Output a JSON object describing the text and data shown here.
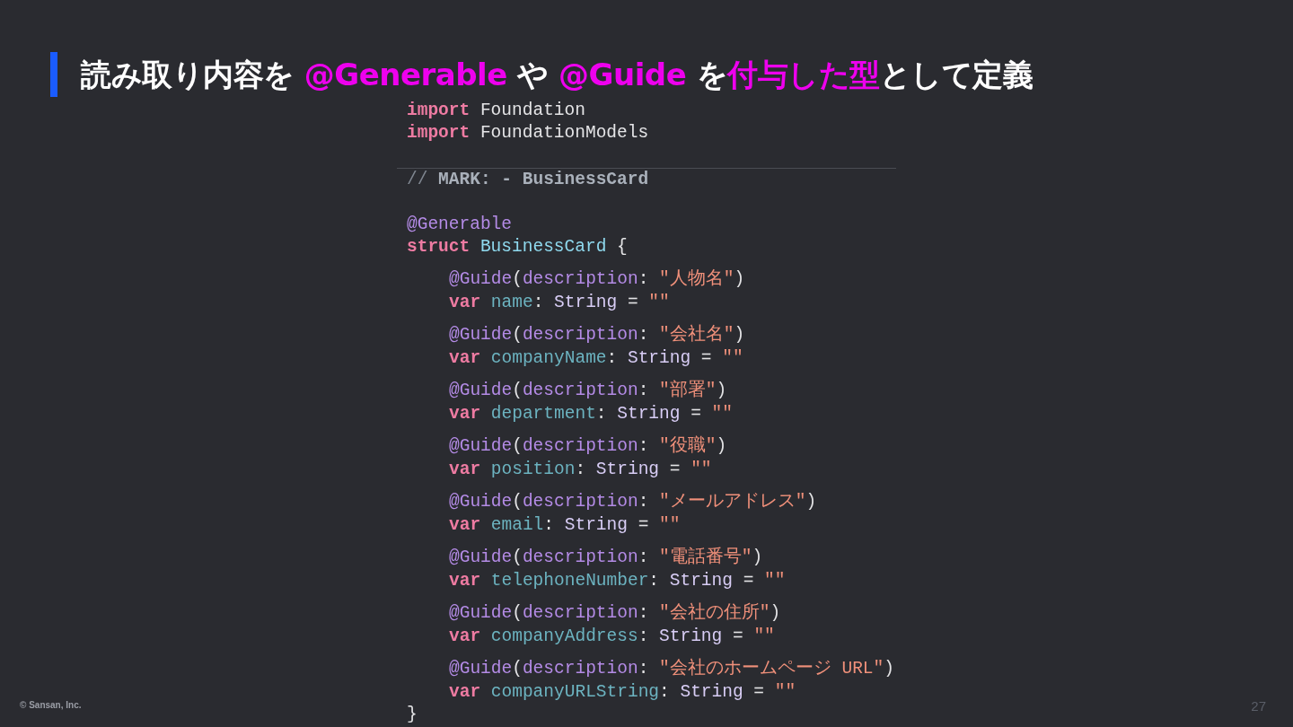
{
  "title": [
    {
      "text": "読み取り内容を ",
      "highlight": false
    },
    {
      "text": "@Generable",
      "highlight": true
    },
    {
      "text": " や ",
      "highlight": false
    },
    {
      "text": "@Guide",
      "highlight": true
    },
    {
      "text": " を",
      "highlight": false
    },
    {
      "text": "付与した型",
      "highlight": true
    },
    {
      "text": "として定義",
      "highlight": false
    }
  ],
  "code_blocks": [
    {
      "kind": "top",
      "lines": [
        [
          {
            "kind": "keyword",
            "text": "import"
          },
          {
            "kind": "plain",
            "text": " Foundation"
          }
        ],
        [
          {
            "kind": "keyword",
            "text": "import"
          },
          {
            "kind": "plain",
            "text": " FoundationModels"
          }
        ]
      ]
    },
    {
      "kind": "mark",
      "lines": [
        [
          {
            "kind": "comment",
            "text": "// "
          },
          {
            "kind": "mark",
            "text": "MARK: - BusinessCard"
          }
        ]
      ]
    },
    {
      "kind": "top",
      "lines": [
        [
          {
            "kind": "attribute",
            "text": "@Generable"
          }
        ],
        [
          {
            "kind": "keyword",
            "text": "struct"
          },
          {
            "kind": "type",
            "text": " BusinessCard"
          },
          {
            "kind": "plain",
            "text": " {"
          }
        ]
      ]
    },
    {
      "kind": "member",
      "lines": [
        [
          {
            "kind": "attribute",
            "text": "@Guide"
          },
          {
            "kind": "plain",
            "text": "("
          },
          {
            "kind": "attribute",
            "text": "description"
          },
          {
            "kind": "plain",
            "text": ": "
          },
          {
            "kind": "string",
            "text": "\"人物名\""
          },
          {
            "kind": "plain",
            "text": ")"
          }
        ],
        [
          {
            "kind": "keyword",
            "text": "var"
          },
          {
            "kind": "property",
            "text": " name"
          },
          {
            "kind": "plain",
            "text": ": "
          },
          {
            "kind": "typename",
            "text": "String"
          },
          {
            "kind": "plain",
            "text": " = "
          },
          {
            "kind": "string",
            "text": "\"\""
          }
        ]
      ]
    },
    {
      "kind": "member",
      "lines": [
        [
          {
            "kind": "attribute",
            "text": "@Guide"
          },
          {
            "kind": "plain",
            "text": "("
          },
          {
            "kind": "attribute",
            "text": "description"
          },
          {
            "kind": "plain",
            "text": ": "
          },
          {
            "kind": "string",
            "text": "\"会社名\""
          },
          {
            "kind": "plain",
            "text": ")"
          }
        ],
        [
          {
            "kind": "keyword",
            "text": "var"
          },
          {
            "kind": "property",
            "text": " companyName"
          },
          {
            "kind": "plain",
            "text": ": "
          },
          {
            "kind": "typename",
            "text": "String"
          },
          {
            "kind": "plain",
            "text": " = "
          },
          {
            "kind": "string",
            "text": "\"\""
          }
        ]
      ]
    },
    {
      "kind": "member",
      "lines": [
        [
          {
            "kind": "attribute",
            "text": "@Guide"
          },
          {
            "kind": "plain",
            "text": "("
          },
          {
            "kind": "attribute",
            "text": "description"
          },
          {
            "kind": "plain",
            "text": ": "
          },
          {
            "kind": "string",
            "text": "\"部署\""
          },
          {
            "kind": "plain",
            "text": ")"
          }
        ],
        [
          {
            "kind": "keyword",
            "text": "var"
          },
          {
            "kind": "property",
            "text": " department"
          },
          {
            "kind": "plain",
            "text": ": "
          },
          {
            "kind": "typename",
            "text": "String"
          },
          {
            "kind": "plain",
            "text": " = "
          },
          {
            "kind": "string",
            "text": "\"\""
          }
        ]
      ]
    },
    {
      "kind": "member",
      "lines": [
        [
          {
            "kind": "attribute",
            "text": "@Guide"
          },
          {
            "kind": "plain",
            "text": "("
          },
          {
            "kind": "attribute",
            "text": "description"
          },
          {
            "kind": "plain",
            "text": ": "
          },
          {
            "kind": "string",
            "text": "\"役職\""
          },
          {
            "kind": "plain",
            "text": ")"
          }
        ],
        [
          {
            "kind": "keyword",
            "text": "var"
          },
          {
            "kind": "property",
            "text": " position"
          },
          {
            "kind": "plain",
            "text": ": "
          },
          {
            "kind": "typename",
            "text": "String"
          },
          {
            "kind": "plain",
            "text": " = "
          },
          {
            "kind": "string",
            "text": "\"\""
          }
        ]
      ]
    },
    {
      "kind": "member",
      "lines": [
        [
          {
            "kind": "attribute",
            "text": "@Guide"
          },
          {
            "kind": "plain",
            "text": "("
          },
          {
            "kind": "attribute",
            "text": "description"
          },
          {
            "kind": "plain",
            "text": ": "
          },
          {
            "kind": "string",
            "text": "\"メールアドレス\""
          },
          {
            "kind": "plain",
            "text": ")"
          }
        ],
        [
          {
            "kind": "keyword",
            "text": "var"
          },
          {
            "kind": "property",
            "text": " email"
          },
          {
            "kind": "plain",
            "text": ": "
          },
          {
            "kind": "typename",
            "text": "String"
          },
          {
            "kind": "plain",
            "text": " = "
          },
          {
            "kind": "string",
            "text": "\"\""
          }
        ]
      ]
    },
    {
      "kind": "member",
      "lines": [
        [
          {
            "kind": "attribute",
            "text": "@Guide"
          },
          {
            "kind": "plain",
            "text": "("
          },
          {
            "kind": "attribute",
            "text": "description"
          },
          {
            "kind": "plain",
            "text": ": "
          },
          {
            "kind": "string",
            "text": "\"電話番号\""
          },
          {
            "kind": "plain",
            "text": ")"
          }
        ],
        [
          {
            "kind": "keyword",
            "text": "var"
          },
          {
            "kind": "property",
            "text": " telephoneNumber"
          },
          {
            "kind": "plain",
            "text": ": "
          },
          {
            "kind": "typename",
            "text": "String"
          },
          {
            "kind": "plain",
            "text": " = "
          },
          {
            "kind": "string",
            "text": "\"\""
          }
        ]
      ]
    },
    {
      "kind": "member",
      "lines": [
        [
          {
            "kind": "attribute",
            "text": "@Guide"
          },
          {
            "kind": "plain",
            "text": "("
          },
          {
            "kind": "attribute",
            "text": "description"
          },
          {
            "kind": "plain",
            "text": ": "
          },
          {
            "kind": "string",
            "text": "\"会社の住所\""
          },
          {
            "kind": "plain",
            "text": ")"
          }
        ],
        [
          {
            "kind": "keyword",
            "text": "var"
          },
          {
            "kind": "property",
            "text": " companyAddress"
          },
          {
            "kind": "plain",
            "text": ": "
          },
          {
            "kind": "typename",
            "text": "String"
          },
          {
            "kind": "plain",
            "text": " = "
          },
          {
            "kind": "string",
            "text": "\"\""
          }
        ]
      ]
    },
    {
      "kind": "member",
      "lines": [
        [
          {
            "kind": "attribute",
            "text": "@Guide"
          },
          {
            "kind": "plain",
            "text": "("
          },
          {
            "kind": "attribute",
            "text": "description"
          },
          {
            "kind": "plain",
            "text": ": "
          },
          {
            "kind": "string",
            "text": "\"会社のホームページ URL\""
          },
          {
            "kind": "plain",
            "text": ")"
          }
        ],
        [
          {
            "kind": "keyword",
            "text": "var"
          },
          {
            "kind": "property",
            "text": " companyURLString"
          },
          {
            "kind": "plain",
            "text": ": "
          },
          {
            "kind": "typename",
            "text": "String"
          },
          {
            "kind": "plain",
            "text": " = "
          },
          {
            "kind": "string",
            "text": "\"\""
          }
        ]
      ]
    },
    {
      "kind": "close",
      "lines": [
        [
          {
            "kind": "plain",
            "text": "}"
          }
        ]
      ]
    }
  ],
  "footer": "© Sansan, Inc.",
  "page_number": "27"
}
